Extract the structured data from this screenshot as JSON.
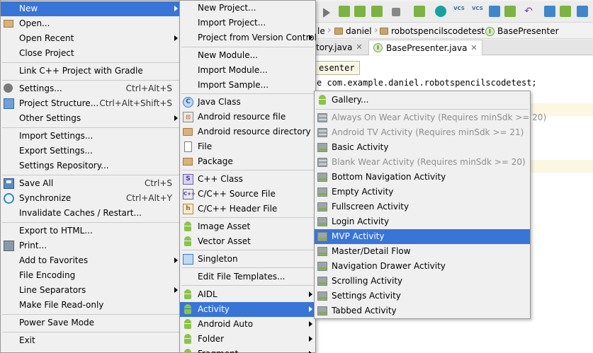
{
  "editor": {
    "breadcrumbs": [
      "daniel",
      "robotspencilscodetest",
      "BasePresenter"
    ],
    "breadcrumb_prefix": "le",
    "tabs": [
      {
        "label": "tory.java",
        "active": false
      },
      {
        "label": "BasePresenter.java",
        "active": true
      }
    ],
    "tooltip": "esenter",
    "code_line": "e com.example.daniel.robotspencilscodetest;",
    "toolbar_vcs_label": "VCS"
  },
  "file_menu": {
    "items": [
      {
        "label": "New",
        "has_submenu": true,
        "highlight": true
      },
      {
        "label": "Open...",
        "icon": "folder-icon"
      },
      {
        "label": "Open Recent",
        "has_submenu": true
      },
      {
        "label": "Close Project"
      },
      {
        "label": "Link C++ Project with Gradle"
      },
      {
        "label": "Settings...",
        "shortcut": "Ctrl+Alt+S",
        "icon": "settings-icon"
      },
      {
        "label": "Project Structure...",
        "shortcut": "Ctrl+Alt+Shift+S",
        "icon": "project-structure-icon"
      },
      {
        "label": "Other Settings",
        "has_submenu": true
      },
      {
        "label": "Import Settings..."
      },
      {
        "label": "Export Settings..."
      },
      {
        "label": "Settings Repository..."
      },
      {
        "label": "Save All",
        "shortcut": "Ctrl+S",
        "icon": "save-icon"
      },
      {
        "label": "Synchronize",
        "shortcut": "Ctrl+Alt+Y",
        "icon": "synchronize-icon"
      },
      {
        "label": "Invalidate Caches / Restart..."
      },
      {
        "label": "Export to HTML..."
      },
      {
        "label": "Print...",
        "icon": "print-icon"
      },
      {
        "label": "Add to Favorites",
        "has_submenu": true
      },
      {
        "label": "File Encoding"
      },
      {
        "label": "Line Separators",
        "has_submenu": true
      },
      {
        "label": "Make File Read-only"
      },
      {
        "label": "Power Save Mode"
      },
      {
        "label": "Exit"
      }
    ]
  },
  "new_menu": {
    "items": [
      {
        "label": "New Project..."
      },
      {
        "label": "Import Project..."
      },
      {
        "label": "Project from Version Control",
        "has_submenu": true
      },
      {
        "label": "New Module..."
      },
      {
        "label": "Import Module..."
      },
      {
        "label": "Import Sample..."
      },
      {
        "label": "Java Class",
        "icon": "java-class-icon",
        "glyph": "C"
      },
      {
        "label": "Android resource file",
        "icon": "android-resource-file-icon",
        "glyph": "⊡"
      },
      {
        "label": "Android resource directory",
        "icon": "folder-icon"
      },
      {
        "label": "File",
        "icon": "file-icon"
      },
      {
        "label": "Package",
        "icon": "package-icon"
      },
      {
        "label": "C++ Class",
        "icon": "cpp-class-icon",
        "glyph": "S"
      },
      {
        "label": "C/C++ Source File",
        "icon": "cpp-source-icon",
        "glyph": "C++"
      },
      {
        "label": "C/C++ Header File",
        "icon": "cpp-header-icon",
        "glyph": "h"
      },
      {
        "label": "Image Asset",
        "icon": "android-icon"
      },
      {
        "label": "Vector Asset",
        "icon": "android-icon"
      },
      {
        "label": "Singleton",
        "icon": "singleton-icon"
      },
      {
        "label": "Edit File Templates..."
      },
      {
        "label": "AIDL",
        "icon": "android-icon",
        "has_submenu": true
      },
      {
        "label": "Activity",
        "icon": "android-icon",
        "has_submenu": true,
        "highlight": true
      },
      {
        "label": "Android Auto",
        "icon": "android-icon",
        "has_submenu": true
      },
      {
        "label": "Folder",
        "icon": "android-icon",
        "has_submenu": true
      },
      {
        "label": "Fragment",
        "icon": "android-icon",
        "has_submenu": true
      }
    ]
  },
  "activity_menu": {
    "items": [
      {
        "label": "Gallery...",
        "icon": "android-icon"
      },
      {
        "label": "Always On Wear Activity (Requires minSdk >= 20)",
        "disabled": true
      },
      {
        "label": "Android TV Activity (Requires minSdk >= 21)",
        "disabled": true
      },
      {
        "label": "Basic Activity"
      },
      {
        "label": "Blank Wear Activity (Requires minSdk >= 20)",
        "disabled": true
      },
      {
        "label": "Bottom Navigation Activity"
      },
      {
        "label": "Empty Activity"
      },
      {
        "label": "Fullscreen Activity"
      },
      {
        "label": "Login Activity"
      },
      {
        "label": "MVP Activity",
        "highlight": true
      },
      {
        "label": "Master/Detail Flow"
      },
      {
        "label": "Navigation Drawer Activity"
      },
      {
        "label": "Scrolling Activity"
      },
      {
        "label": "Settings Activity"
      },
      {
        "label": "Tabbed Activity"
      }
    ]
  },
  "colors": {
    "highlight": "#3875d7",
    "menu_bg": "#f0f0f0",
    "android_green": "#8bc34a"
  }
}
